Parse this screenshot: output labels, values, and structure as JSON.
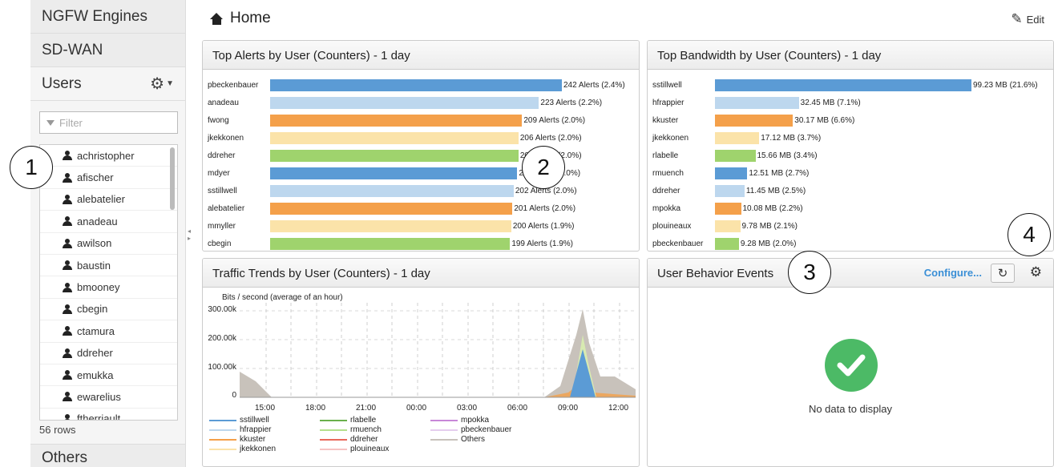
{
  "sidebar": {
    "sections": [
      "NGFW Engines",
      "SD-WAN",
      "Users"
    ],
    "filter_placeholder": "Filter",
    "users": [
      "achristopher",
      "afischer",
      "alebatelier",
      "anadeau",
      "awilson",
      "baustin",
      "bmooney",
      "cbegin",
      "ctamura",
      "ddreher",
      "emukka",
      "ewarelius",
      "ftherriault"
    ],
    "rows_count": "56 rows",
    "others": "Others"
  },
  "header": {
    "title": "Home",
    "edit_label": "Edit"
  },
  "alerts": {
    "title": "Top Alerts by User (Counters) - 1 day",
    "rows": [
      {
        "user": "pbeckenbauer",
        "label": "242 Alerts (2.4%)",
        "value": 242,
        "color": "#5b9bd5"
      },
      {
        "user": "anadeau",
        "label": "223 Alerts (2.2%)",
        "value": 223,
        "color": "#bdd7ee"
      },
      {
        "user": "fwong",
        "label": "209 Alerts (2.0%)",
        "value": 209,
        "color": "#f4a04a"
      },
      {
        "user": "jkekkonen",
        "label": "206 Alerts (2.0%)",
        "value": 206,
        "color": "#fbe3a9"
      },
      {
        "user": "ddreher",
        "label": "206 Alerts (2.0%)",
        "value": 206,
        "color": "#9fd36d"
      },
      {
        "user": "mdyer",
        "label": "205 Alerts (2.0%)",
        "value": 205,
        "color": "#5b9bd5"
      },
      {
        "user": "sstillwell",
        "label": "202 Alerts (2.0%)",
        "value": 202,
        "color": "#bdd7ee"
      },
      {
        "user": "alebatelier",
        "label": "201 Alerts (2.0%)",
        "value": 201,
        "color": "#f4a04a"
      },
      {
        "user": "mmyller",
        "label": "200 Alerts (1.9%)",
        "value": 200,
        "color": "#fbe3a9"
      },
      {
        "user": "cbegin",
        "label": "199 Alerts (1.9%)",
        "value": 199,
        "color": "#9fd36d"
      }
    ]
  },
  "bandwidth": {
    "title": "Top Bandwidth by User (Counters) - 1 day",
    "rows": [
      {
        "user": "sstillwell",
        "label": "99.23 MB (21.6%)",
        "value": 99.23,
        "color": "#5b9bd5"
      },
      {
        "user": "hfrappier",
        "label": "32.45 MB (7.1%)",
        "value": 32.45,
        "color": "#bdd7ee"
      },
      {
        "user": "kkuster",
        "label": "30.17 MB (6.6%)",
        "value": 30.17,
        "color": "#f4a04a"
      },
      {
        "user": "jkekkonen",
        "label": "17.12 MB (3.7%)",
        "value": 17.12,
        "color": "#fbe3a9"
      },
      {
        "user": "rlabelle",
        "label": "15.66 MB (3.4%)",
        "value": 15.66,
        "color": "#9fd36d"
      },
      {
        "user": "rmuench",
        "label": "12.51 MB (2.7%)",
        "value": 12.51,
        "color": "#5b9bd5"
      },
      {
        "user": "ddreher",
        "label": "11.45 MB (2.5%)",
        "value": 11.45,
        "color": "#bdd7ee"
      },
      {
        "user": "mpokka",
        "label": "10.08 MB (2.2%)",
        "value": 10.08,
        "color": "#f4a04a"
      },
      {
        "user": "plouineaux",
        "label": "9.78 MB (2.1%)",
        "value": 9.78,
        "color": "#fbe3a9"
      },
      {
        "user": "pbeckenbauer",
        "label": "9.28 MB (2.0%)",
        "value": 9.28,
        "color": "#9fd36d"
      }
    ]
  },
  "traffic": {
    "title": "Traffic Trends by User (Counters) - 1 day",
    "ylabel": "Bits / second (average of an hour)",
    "yticks": [
      "300.00k",
      "200.00k",
      "100.00k",
      "0"
    ],
    "xticks": [
      "15:00",
      "18:00",
      "21:00",
      "00:00",
      "03:00",
      "06:00",
      "09:00",
      "12:00"
    ],
    "legend": [
      {
        "name": "sstillwell",
        "color": "#5b9bd5"
      },
      {
        "name": "hfrappier",
        "color": "#bdd7ee"
      },
      {
        "name": "kkuster",
        "color": "#f4a04a"
      },
      {
        "name": "jkekkonen",
        "color": "#fbe3a9"
      },
      {
        "name": "rlabelle",
        "color": "#6ab04c"
      },
      {
        "name": "rmuench",
        "color": "#b5e08e"
      },
      {
        "name": "ddreher",
        "color": "#e9685a"
      },
      {
        "name": "plouineaux",
        "color": "#f6c3c3"
      },
      {
        "name": "mpokka",
        "color": "#c887d8"
      },
      {
        "name": "pbeckenbauer",
        "color": "#e5cdee"
      },
      {
        "name": "Others",
        "color": "#c8c2bb"
      }
    ]
  },
  "behavior": {
    "title": "User Behavior Events",
    "configure_label": "Configure...",
    "no_data": "No data to display"
  },
  "callouts": [
    "1",
    "2",
    "3",
    "4"
  ]
}
